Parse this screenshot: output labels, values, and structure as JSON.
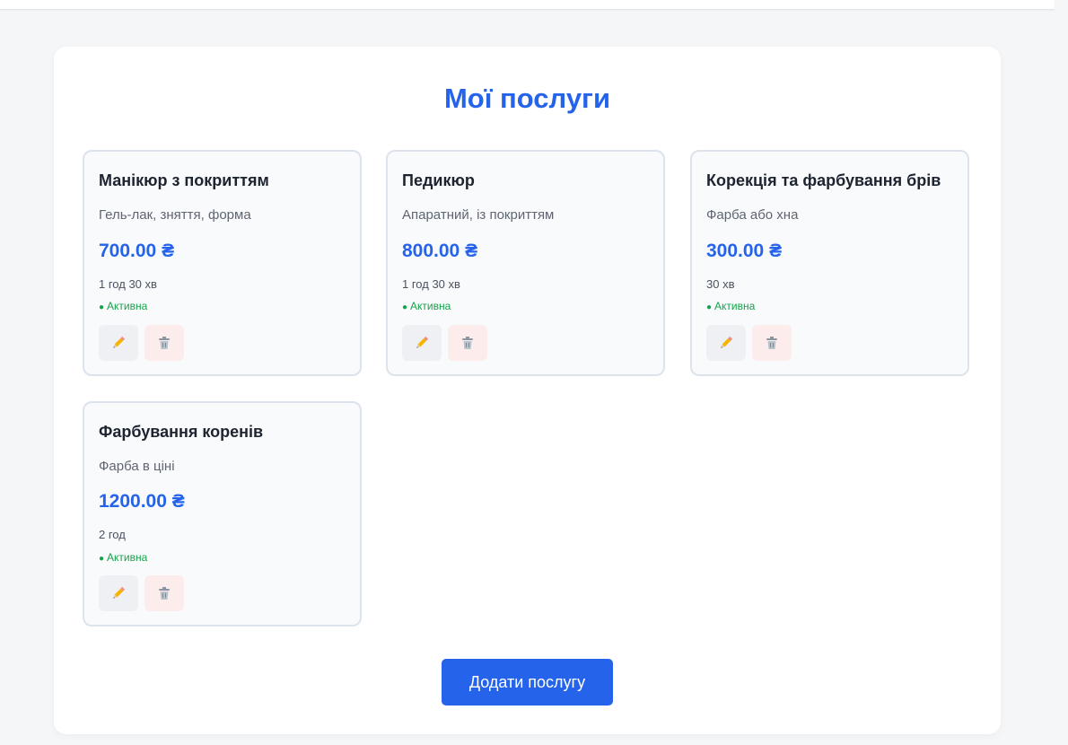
{
  "page": {
    "title": "Мої послуги",
    "add_button_label": "Додати послугу"
  },
  "services": [
    {
      "name": "Манікюр з покриттям",
      "description": "Гель-лак, зняття, форма",
      "price": "700.00 ₴",
      "duration": "1 год 30 хв",
      "status": "Активна"
    },
    {
      "name": "Педикюр",
      "description": "Апаратний, із покриттям",
      "price": "800.00 ₴",
      "duration": "1 год 30 хв",
      "status": "Активна"
    },
    {
      "name": "Корекція та фарбування брів",
      "description": "Фарба або хна",
      "price": "300.00 ₴",
      "duration": "30 хв",
      "status": "Активна"
    },
    {
      "name": "Фарбування коренів",
      "description": "Фарба в ціні",
      "price": "1200.00 ₴",
      "duration": "2 год",
      "status": "Активна"
    }
  ],
  "icons": {
    "edit": "pencil-icon",
    "delete": "trash-icon"
  },
  "colors": {
    "accent": "#2563eb",
    "status_active": "#16a34a",
    "delete_bg": "#fdecec",
    "edit_bg": "#eef0f3"
  }
}
